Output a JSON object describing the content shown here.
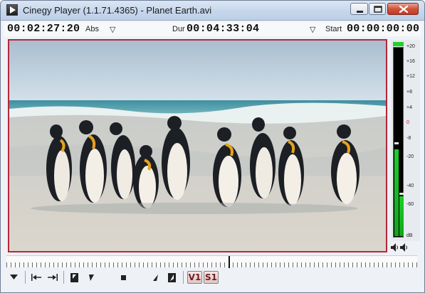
{
  "window": {
    "title": "Cinegy Player (1.1.71.4365) - Planet Earth.avi",
    "buttons": [
      "minimize-icon",
      "maximize-icon",
      "close-icon"
    ]
  },
  "timecodes": {
    "current": "00:02:27:20",
    "current_mode": "Abs",
    "duration_label": "Dur",
    "duration": "00:04:33:04",
    "start_label": "Start",
    "start": "00:00:00:00",
    "dropdown_glyph": "▽"
  },
  "video": {
    "content": "penguins-on-beach-frame",
    "frame_border_color": "#b4273b"
  },
  "audio_meter": {
    "unit": "dB",
    "scale": [
      "+20",
      "+16",
      "+12",
      "+8",
      "+4",
      "0",
      "-8",
      "-20",
      "-40",
      "-60"
    ],
    "level_left_fraction": 0.46,
    "level_right_fraction": 0.21,
    "hold_left_fraction": 0.49,
    "hold_right_fraction": 0.22,
    "clip_indicator_color": "#22d129"
  },
  "timeline": {
    "playhead_fraction": 0.54
  },
  "controls": {
    "items": [
      "dropdown-icon",
      "go-to-start-icon",
      "go-to-end-icon",
      "mark-in-icon",
      "step-back-icon",
      "stop-icon",
      "step-forward-icon",
      "mark-out-icon"
    ],
    "video_track": "V1",
    "subtitle_track": "S1"
  }
}
